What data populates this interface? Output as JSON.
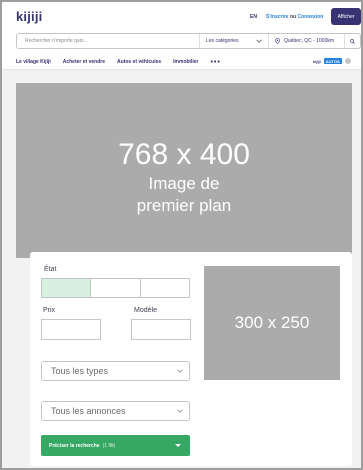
{
  "header": {
    "logo": "kijiji",
    "language": "EN",
    "register_text": "S'inscrire",
    "or_text": "ou",
    "login_text": "Connexion",
    "post_button": "Afficher"
  },
  "search": {
    "placeholder": "Rechercher n'importe quoi...",
    "category": "Les catégories",
    "location": "Québec, QC - 1000km"
  },
  "nav": {
    "items": [
      "Le village Kijiji",
      "Acheter et vendre",
      "Autos et véhicules",
      "Immobilier"
    ],
    "more": "•••",
    "autos_brand": "kijiji",
    "autos_tag": "AUTOS"
  },
  "hero": {
    "size": "768 x 400",
    "caption": "Image de premier plan"
  },
  "filters": {
    "state_label": "État",
    "price_label": "Prix",
    "model_label": "Modèle",
    "types_select": "Tous les types",
    "ads_select": "Tous les annonces",
    "refine_button": "Préciser la recherche",
    "refine_count": "(1 filt)"
  },
  "side_ad": {
    "size": "300 x 250"
  },
  "colors": {
    "brand": "#373373",
    "link": "#2681db",
    "green": "#37a864",
    "placeholder_gray": "#ababab"
  }
}
